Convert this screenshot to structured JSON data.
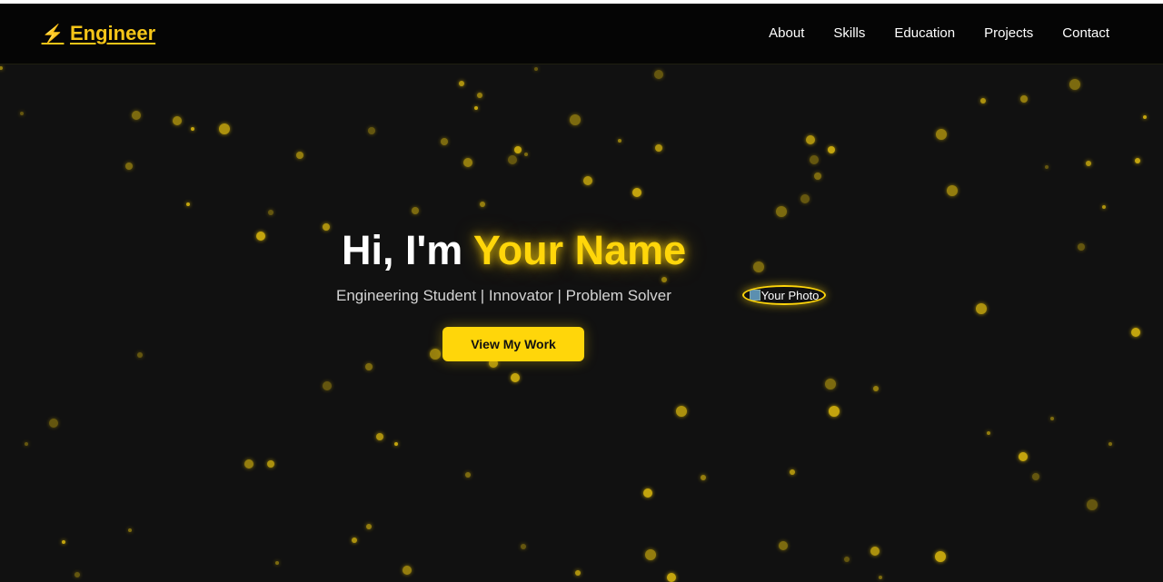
{
  "brand": {
    "logo_text": "Engineer",
    "logo_icon": "lightning-bolt-icon",
    "accent_color": "#ffd60a"
  },
  "nav": {
    "items": [
      {
        "label": "About"
      },
      {
        "label": "Skills"
      },
      {
        "label": "Education"
      },
      {
        "label": "Projects"
      },
      {
        "label": "Contact"
      }
    ]
  },
  "hero": {
    "greeting": "Hi, I'm ",
    "name": "Your Name",
    "subtitle": "Engineering Student | Innovator | Problem Solver",
    "cta_label": "View My Work",
    "photo_alt": "Your Photo"
  }
}
